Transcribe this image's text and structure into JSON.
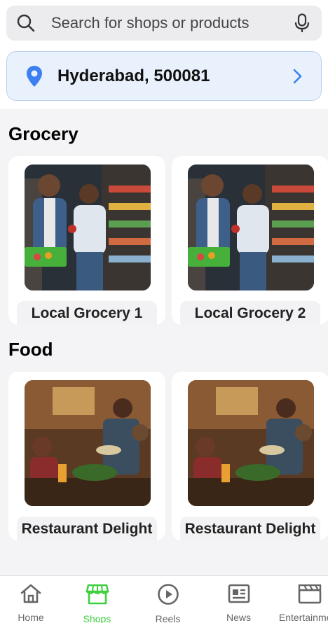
{
  "search": {
    "placeholder": "Search for shops or products"
  },
  "location": {
    "text": "Hyderabad, 500081"
  },
  "sections": [
    {
      "title": "Grocery",
      "cards": [
        {
          "label": "Local Grocery 1"
        },
        {
          "label": "Local Grocery 2"
        }
      ]
    },
    {
      "title": "Food",
      "cards": [
        {
          "label": "Restaurant Delight"
        },
        {
          "label": "Restaurant Delight"
        }
      ]
    }
  ],
  "nav": [
    {
      "label": "Home",
      "icon": "home-icon",
      "active": false
    },
    {
      "label": "Shops",
      "icon": "store-icon",
      "active": true
    },
    {
      "label": "Reels",
      "icon": "play-icon",
      "active": false
    },
    {
      "label": "News",
      "icon": "newspaper-icon",
      "active": false
    },
    {
      "label": "Entertainment",
      "icon": "clapperboard-icon",
      "active": false
    }
  ],
  "colors": {
    "accent": "#3fcf3f",
    "location_bg": "#e9f1fc",
    "pin": "#3b7ff0"
  }
}
